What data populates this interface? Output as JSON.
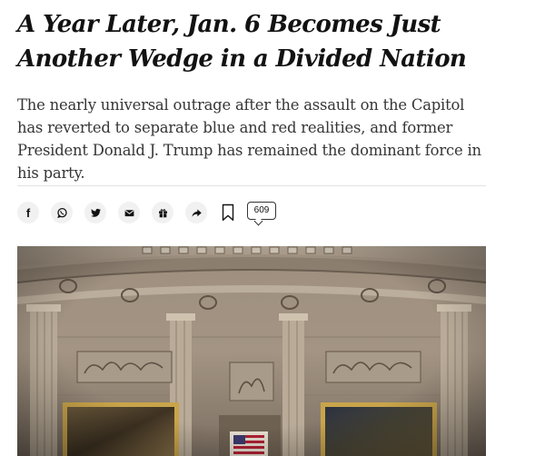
{
  "article": {
    "headline": "A Year Later, Jan. 6 Becomes Just Another Wedge in a Divided Nation",
    "summary": "The nearly universal outrage after the assault on the Capitol has reverted to separate blue and red realities, and former President Donald J. Trump has remained the dominant force in his party."
  },
  "share_bar": {
    "buttons": [
      {
        "name": "facebook",
        "icon": "facebook-icon"
      },
      {
        "name": "whatsapp",
        "icon": "whatsapp-icon"
      },
      {
        "name": "twitter",
        "icon": "twitter-icon"
      },
      {
        "name": "email",
        "icon": "email-icon"
      },
      {
        "name": "gift",
        "icon": "gift-icon"
      },
      {
        "name": "share",
        "icon": "share-arrow-icon"
      }
    ],
    "bookmark_icon": "bookmark-icon",
    "comment_count": "609",
    "facebook_glyph": "f"
  },
  "image": {
    "subject": "Capitol Rotunda interior"
  }
}
